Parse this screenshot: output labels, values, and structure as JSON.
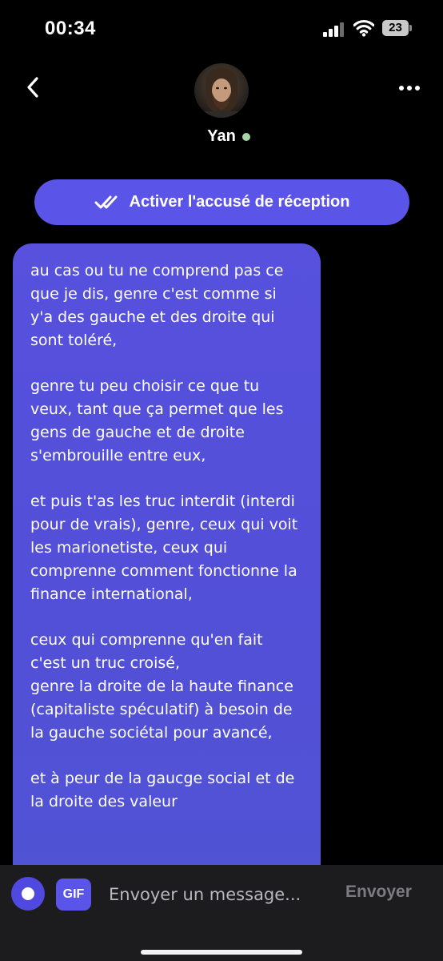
{
  "status_bar": {
    "time": "00:34",
    "battery_level": "23",
    "icons": [
      "signal-icon",
      "wifi-icon",
      "battery-icon"
    ]
  },
  "header": {
    "contact_name": "Yan",
    "online": true,
    "icons": [
      "back-icon",
      "more-icon"
    ]
  },
  "read_receipt": {
    "label": "Activer l'accusé de réception",
    "icon": "double-check-icon"
  },
  "message": {
    "paragraphs": [
      "au cas ou tu ne comprend pas ce que je dis, genre c'est comme si y'a des gauche et des droite qui sont toléré,",
      "genre tu peu choisir ce que tu veux, tant que ça permet que les gens de gauche et de droite s'embrouille entre eux,",
      "et puis t'as les truc interdit (interdi pour de vrais), genre, ceux qui voit les marionetiste, ceux qui comprenne comment fonctionne la finance international,",
      "ceux qui comprenne qu'en fait c'est un truc croisé,\ngenre la droite de la haute finance (capitaliste spéculatif) à besoin de la gauche sociétal pour avancé,",
      "et à peur de la gaucge social et de la droite des valeur"
    ]
  },
  "composer": {
    "gif_label": "GIF",
    "placeholder": "Envoyer un message...",
    "send_label": "Envoyer"
  },
  "colors": {
    "accent": "#5b54e8",
    "bubble": "#534fd8",
    "online_dot": "#a6d6a6",
    "background": "#000000"
  }
}
